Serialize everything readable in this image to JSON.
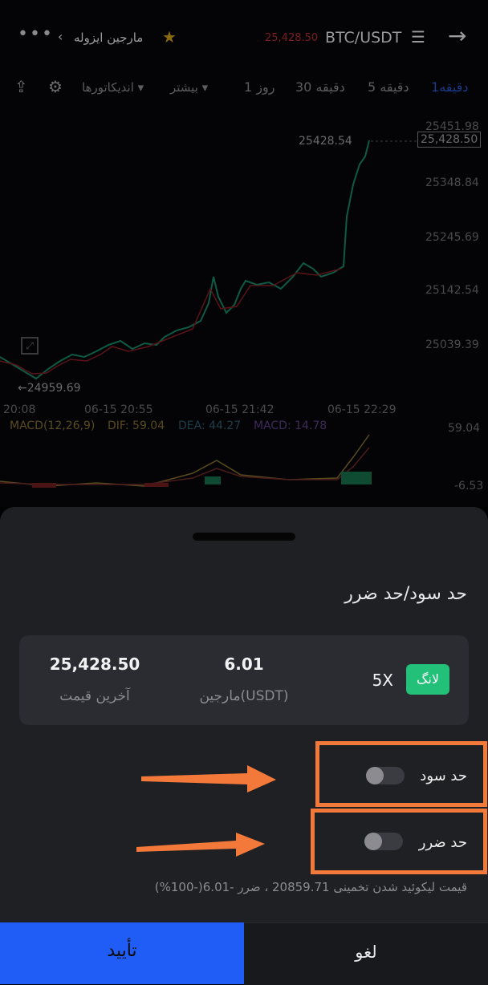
{
  "header": {
    "menu_icon": "more-dots-icon",
    "back_chevron_icon": "chevron-left-icon",
    "margin_mode": "مارجین ایزوله",
    "favorite_icon": "star-icon",
    "price": "25,428.50",
    "pair": "BTC/USDT",
    "list_icon": "list-icon",
    "forward_icon": "arrow-right-icon"
  },
  "timeframes": {
    "share_icon": "share-icon",
    "settings_icon": "gear-icon",
    "indicators": "اندیکاتورها",
    "more": "بیشتر",
    "items": [
      "1 روز",
      "30 دقیقه",
      "5 دقیقه",
      "1دقیقه"
    ]
  },
  "chart": {
    "price_ticks": [
      "25451.98",
      "25348.84",
      "25245.69",
      "25142.54",
      "25039.39",
      "59.04",
      "-6.53"
    ],
    "last_price_tag": "25,428.50",
    "high_label": "25428.54",
    "low_label": "←24959.69",
    "time_ticks": [
      "20:08",
      "06-15 20:55",
      "06-15 21:42",
      "06-15 22:29"
    ],
    "macd_title": "MACD(12,26,9)",
    "macd_dif": "DIF: 59.04",
    "macd_dea": "DEA: 44.27",
    "macd_value": "MACD: 14.78",
    "expand_icon": "expand-icon"
  },
  "sheet": {
    "title": "حد سود/حد ضرر",
    "last_price_value": "25,428.50",
    "last_price_label": "آخرین قیمت",
    "margin_value": "6.01",
    "margin_label": "مارجین(USDT)",
    "leverage": "5X",
    "side_badge": "لانگ",
    "take_profit_label": "حد سود",
    "stop_loss_label": "حد ضرر",
    "liquidation_note": "قیمت لیکوئید شدن تخمینی 20859.71 ، ضرر -6.01(-100%)",
    "confirm": "تأیید",
    "cancel": "لغو"
  },
  "colors": {
    "accent_blue": "#1f5df6",
    "long_green": "#23c07a",
    "annotation_orange": "#f2793a"
  }
}
